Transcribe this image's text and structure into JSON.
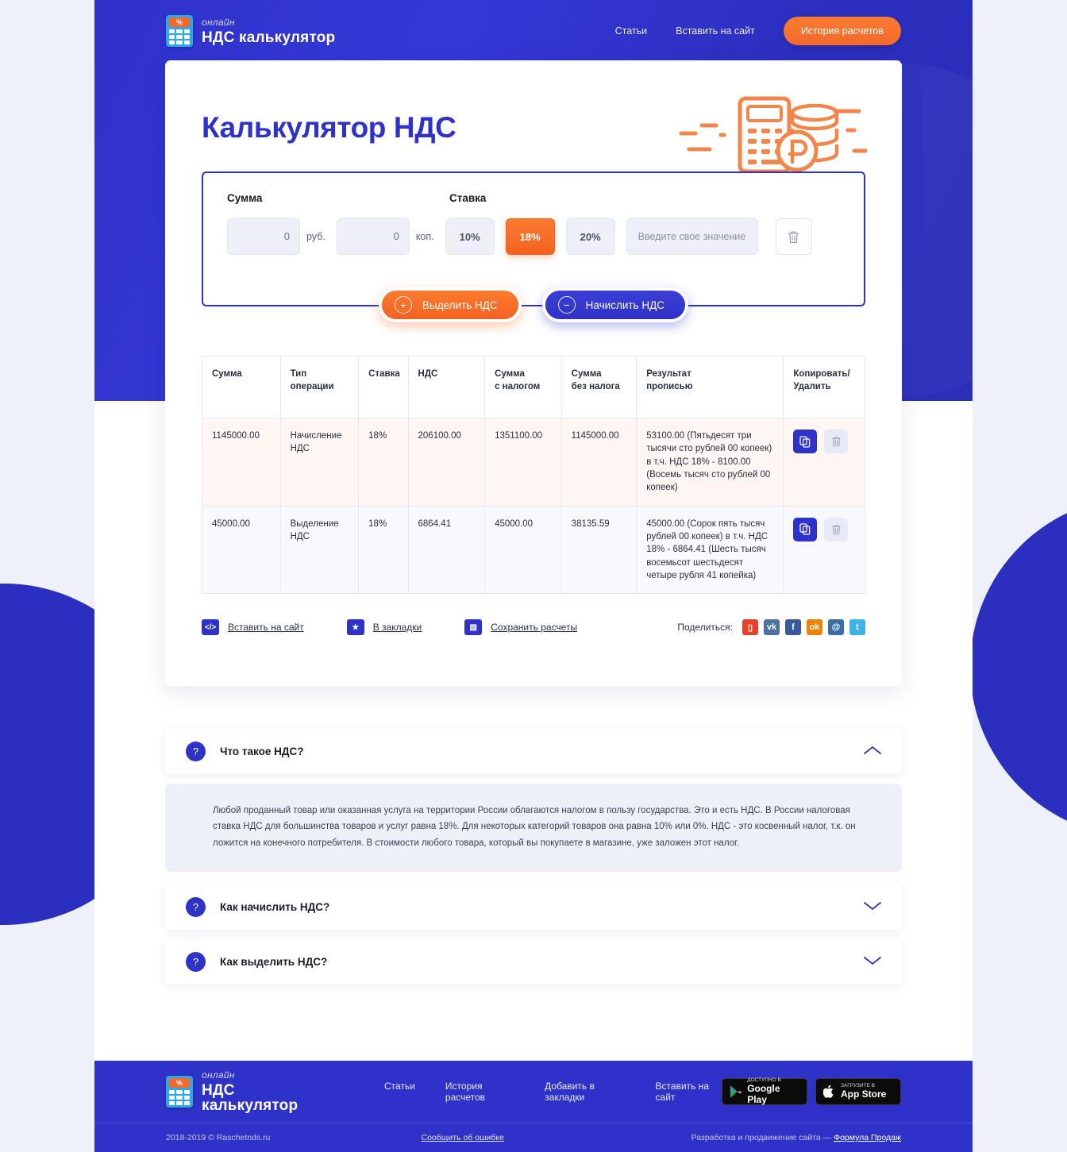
{
  "header": {
    "logo": {
      "sub": "онлайн",
      "title": "НДС калькулятор",
      "icon": "calculator-icon",
      "badge": "%"
    },
    "nav": [
      {
        "label": "Статьи"
      },
      {
        "label": "Вставить на сайт"
      }
    ],
    "cta": "История расчетов"
  },
  "main": {
    "page_title": "Калькулятор НДС",
    "calc": {
      "label_amount": "Сумма",
      "label_rate": "Ставка",
      "rub_value": "0",
      "rub_unit": "руб.",
      "kop_value": "0",
      "kop_unit": "коп.",
      "rates": [
        {
          "label": "10%",
          "active": false
        },
        {
          "label": "18%",
          "active": true
        },
        {
          "label": "20%",
          "active": false
        }
      ],
      "custom_rate_placeholder": "Введите свое значение",
      "clear_icon": "trash-icon"
    },
    "actions": [
      {
        "label": "Выделить НДС",
        "icon": "plus-circle-icon",
        "style": "orange"
      },
      {
        "label": "Начислить НДС",
        "icon": "minus-circle-icon",
        "style": "blue"
      }
    ],
    "table": {
      "columns": [
        "Сумма",
        "Тип\nоперации",
        "Ставка",
        "НДС",
        "Сумма\nс налогом",
        "Сумма\nбез налога",
        "Результат\nпрописью",
        "Копировать/\nУдалить"
      ],
      "rows": [
        {
          "amount": "1145000.00",
          "type": "Начисление НДС",
          "rate": "18%",
          "vat": "206100.00",
          "with_tax": "1351100.00",
          "without_tax": "1145000.00",
          "words": "53100.00 (Пятьдесят три тысячи сто рублей 00 копеек) в т.ч. НДС 18% - 8100.00 (Восемь тысяч сто рублей 00 копеек)"
        },
        {
          "amount": "45000.00",
          "type": "Выделение НДС",
          "rate": "18%",
          "vat": "6864.41",
          "with_tax": "45000.00",
          "without_tax": "38135.59",
          "words": "45000.00 (Сорок пять тысяч рублей 00 копеек) в т.ч. НДС 18% - 6864.41 (Шесть тысяч восемьсот шестьдесят четыре рубля 41 копейка)"
        }
      ]
    },
    "toolbar": {
      "items": [
        {
          "label": "Вставить на сайт",
          "icon": "code-icon",
          "glyph": "</>"
        },
        {
          "label": "В закладки",
          "icon": "star-icon",
          "glyph": "★"
        },
        {
          "label": "Сохранить расчеты",
          "icon": "save-icon",
          "glyph": "▤"
        }
      ],
      "share_label": "Поделиться:",
      "share_icons": [
        {
          "name": "bookmark-icon",
          "glyph": "▯",
          "color": "#e8412a"
        },
        {
          "name": "vk-icon",
          "glyph": "vk",
          "color": "#4b72a0"
        },
        {
          "name": "facebook-icon",
          "glyph": "f",
          "color": "#3a5a9b"
        },
        {
          "name": "odnoklassniki-icon",
          "glyph": "ok",
          "color": "#ee8208"
        },
        {
          "name": "mailru-icon",
          "glyph": "@",
          "color": "#3a6ea8"
        },
        {
          "name": "twitter-icon",
          "glyph": "t",
          "color": "#3fb2e8"
        }
      ]
    }
  },
  "faq": {
    "items": [
      {
        "question": "Что такое НДС?",
        "open": true,
        "chevron": "chevron-up-icon",
        "answer": "Любой проданный товар или оказанная услуга на территории России облагаются налогом в пользу государства. Это и есть НДС. В России налоговая ставка НДС для большинства товаров и услуг равна 18%. Для некоторых категорий товаров она равна 10% или 0%. НДС - это косвенный налог, т.к. он ложится на конечного потребителя. В стоимости любого товара, который вы покупаете в магазине, уже заложен этот налог."
      },
      {
        "question": "Как начислить НДС?",
        "open": false,
        "chevron": "chevron-down-icon",
        "answer": ""
      },
      {
        "question": "Как выделить НДС?",
        "open": false,
        "chevron": "chevron-down-icon",
        "answer": ""
      }
    ]
  },
  "footer": {
    "logo": {
      "sub": "онлайн",
      "title": "НДС калькулятор"
    },
    "nav": [
      {
        "label": "Статьи"
      },
      {
        "label": "История расчетов"
      },
      {
        "label": "Добавить в закладки"
      },
      {
        "label": "Вставить на сайт"
      }
    ],
    "stores": [
      {
        "small": "доступно в",
        "big": "Google Play",
        "icon": "google-play-icon"
      },
      {
        "small": "Загрузите в",
        "big": "App Store",
        "icon": "apple-icon"
      }
    ],
    "copyright": "2018-2019 © Raschetnds.ru",
    "report_link": "Сообщить об ошибке",
    "credit_prefix": "Разработка и продвижение сайта — ",
    "credit_link": "Формула Продаж"
  },
  "colors": {
    "brand_blue": "#2f32c9",
    "accent_orange": "#f4692a",
    "page_bg": "#eef0fa"
  }
}
